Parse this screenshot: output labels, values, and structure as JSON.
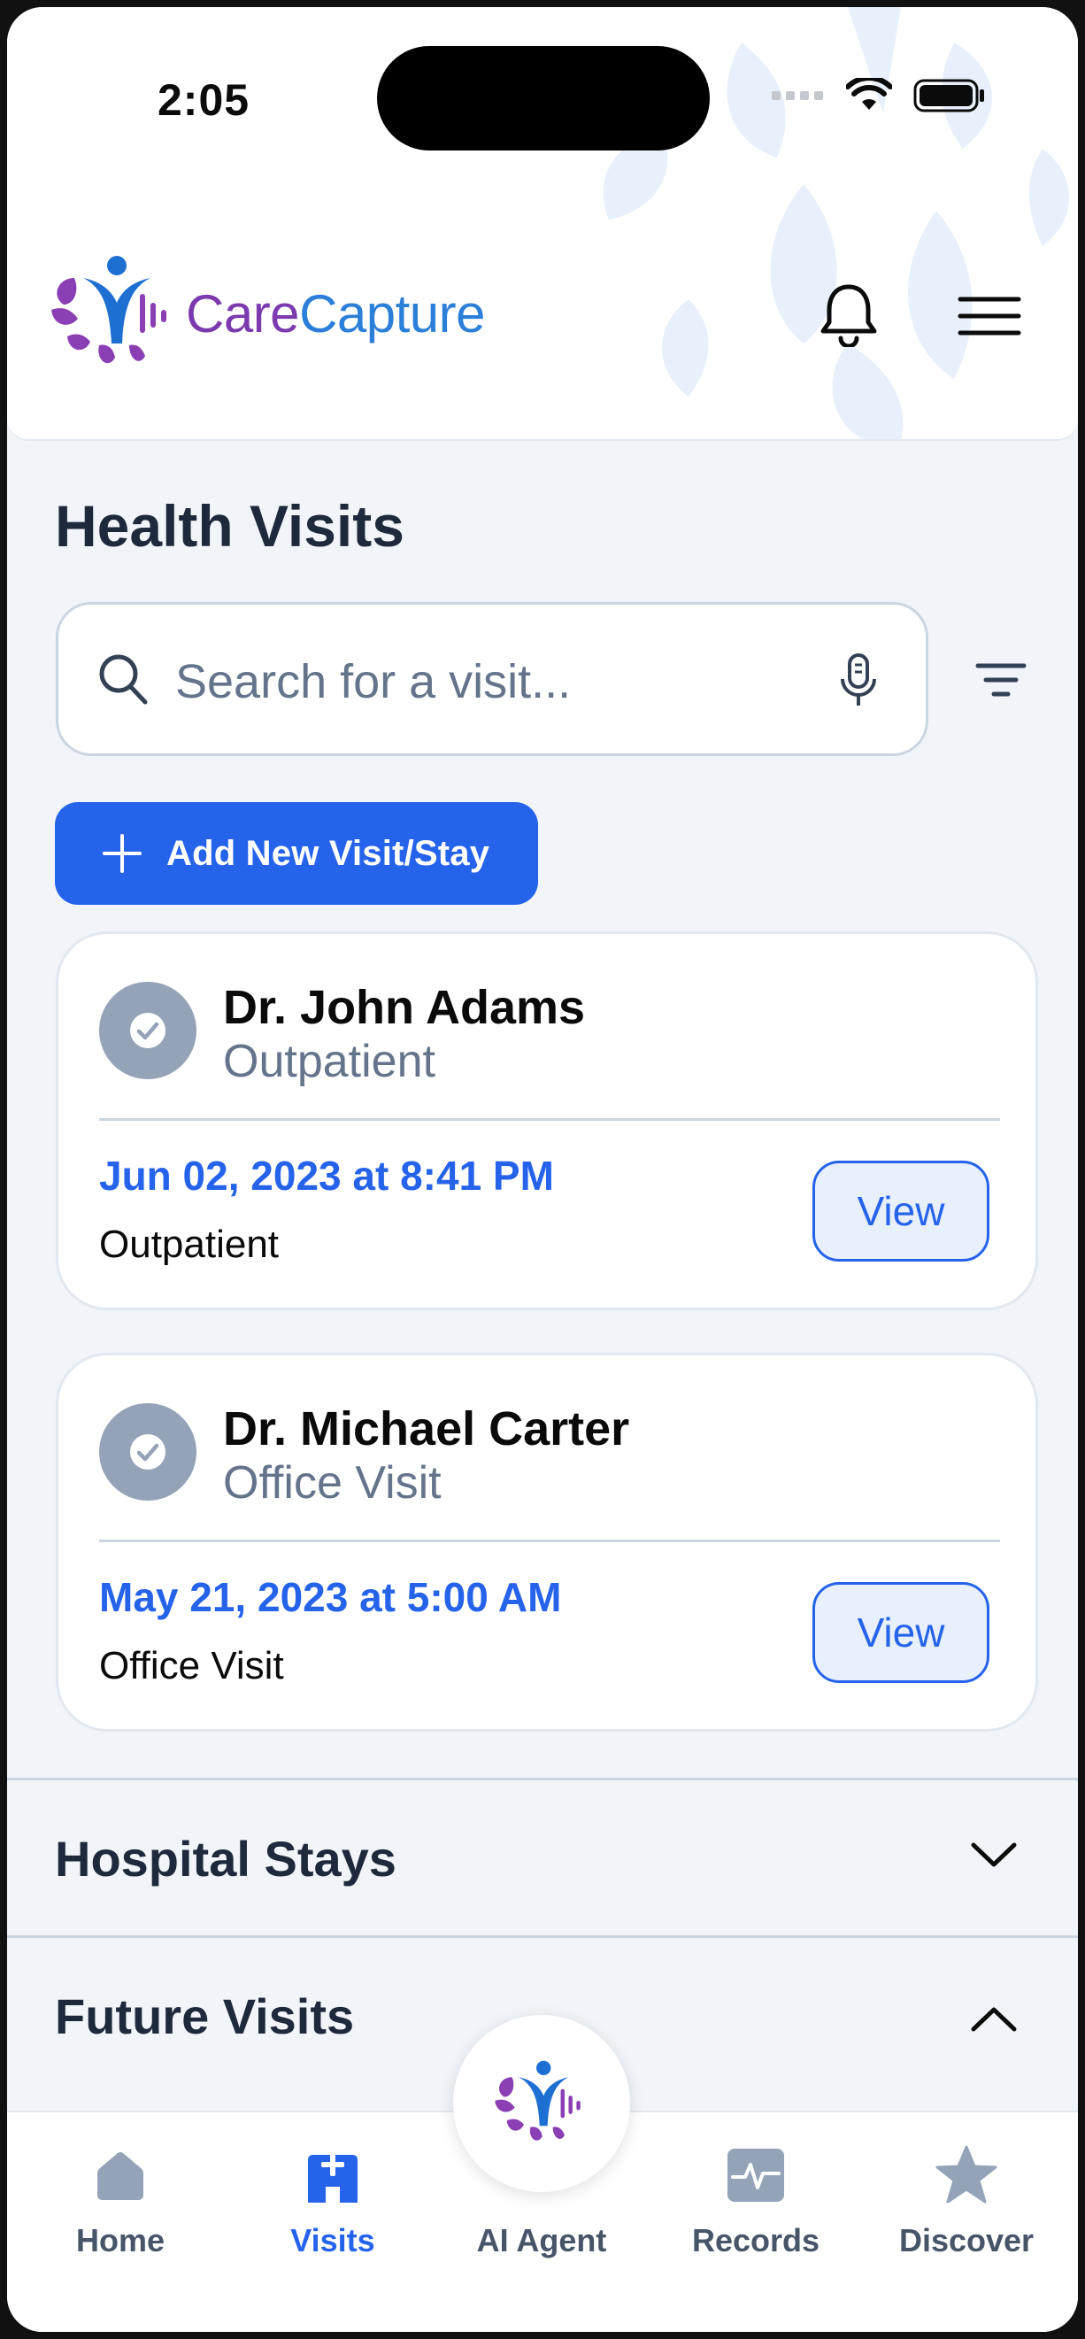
{
  "status_bar": {
    "time": "2:05"
  },
  "app": {
    "logo_part1": "Care",
    "logo_part2": "Capture"
  },
  "page": {
    "title": "Health Visits"
  },
  "search": {
    "placeholder": "Search for a visit..."
  },
  "actions": {
    "add_label": "Add New Visit/Stay"
  },
  "visits": [
    {
      "doctor": "Dr. John Adams",
      "type": "Outpatient",
      "datetime": "Jun 02, 2023 at 8:41 PM",
      "kind": "Outpatient",
      "view_label": "View"
    },
    {
      "doctor": "Dr. Michael Carter",
      "type": "Office Visit",
      "datetime": "May 21, 2023 at 5:00 AM",
      "kind": "Office Visit",
      "view_label": "View"
    }
  ],
  "sections": {
    "hospital_stays": {
      "title": "Hospital Stays",
      "expanded": false
    },
    "future_visits": {
      "title": "Future Visits",
      "expanded": true
    }
  },
  "nav": {
    "items": [
      {
        "label": "Home",
        "icon": "home-icon",
        "active": false
      },
      {
        "label": "Visits",
        "icon": "hospital-icon",
        "active": true
      },
      {
        "label": "AI Agent",
        "icon": "ai-agent-logo-icon",
        "active": false
      },
      {
        "label": "Records",
        "icon": "activity-icon",
        "active": false
      },
      {
        "label": "Discover",
        "icon": "star-icon",
        "active": false
      }
    ]
  },
  "colors": {
    "primary": "#2563eb",
    "brand_purple": "#7c3aaf",
    "brand_blue": "#2b7fd8",
    "muted": "#64748b"
  }
}
